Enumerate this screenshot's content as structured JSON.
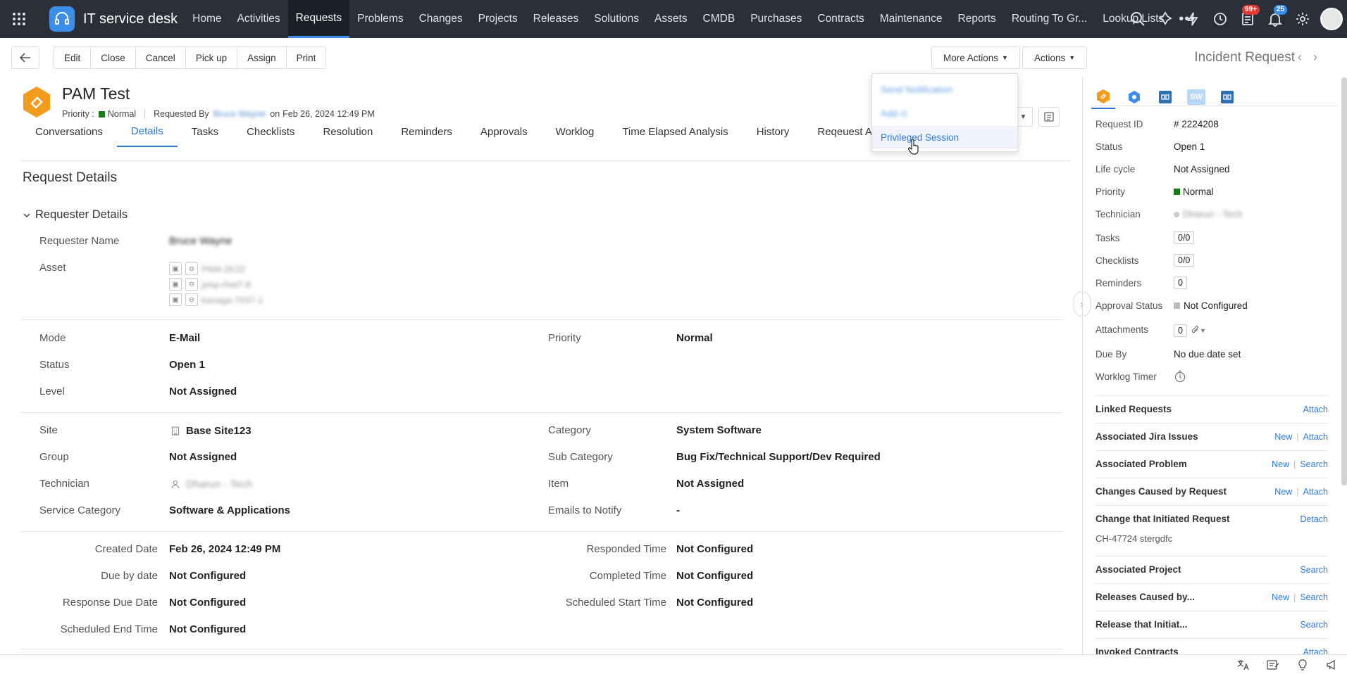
{
  "topbar": {
    "app_name": "IT service desk",
    "nav": [
      "Home",
      "Activities",
      "Requests",
      "Problems",
      "Changes",
      "Projects",
      "Releases",
      "Solutions",
      "Assets",
      "CMDB",
      "Purchases",
      "Contracts",
      "Maintenance",
      "Reports",
      "Routing To Gr...",
      "Lookup Lists"
    ],
    "active_nav": "Requests",
    "more_label": "•••",
    "badges": {
      "tasks": "99+",
      "notifications": "25"
    }
  },
  "toolbar": {
    "buttons": [
      "Edit",
      "Close",
      "Cancel",
      "Pick up",
      "Assign",
      "Print"
    ],
    "more_actions": "More Actions",
    "actions": "Actions",
    "record_type": "Incident Request"
  },
  "more_actions_menu": {
    "items": [
      "Send Notification",
      "Add ci",
      "Privileged Session"
    ],
    "highlighted": "Privileged Session"
  },
  "request": {
    "title": "PAM Test",
    "priority_label": "Priority :",
    "priority": "Normal",
    "requested_by_label": "Requested By",
    "requester": "Bruce Wayne",
    "on_label": "on",
    "date": "Feb 26, 2024 12:49 PM"
  },
  "tabs": [
    "Conversations",
    "Details",
    "Tasks",
    "Checklists",
    "Resolution",
    "Reminders",
    "Approvals",
    "Worklog",
    "Time Elapsed Analysis",
    "History",
    "Reqeuest Appro"
  ],
  "active_tab": "Details",
  "details": {
    "section_title": "Request Details",
    "requester_section": "Requester Details",
    "requester_name_label": "Requester Name",
    "requester_name": "Bruce Wayne",
    "asset_label": "Asset",
    "assets": [
      "PAM-2K22",
      "pmp-rhel7-8",
      "kanaga-7037-1"
    ],
    "mode_label": "Mode",
    "mode": "E-Mail",
    "priority_label": "Priority",
    "priority": "Normal",
    "status_label": "Status",
    "status": "Open 1",
    "level_label": "Level",
    "level": "Not Assigned",
    "site_label": "Site",
    "site": "Base Site123",
    "category_label": "Category",
    "category": "System Software",
    "group_label": "Group",
    "group": "Not Assigned",
    "subcategory_label": "Sub Category",
    "subcategory": "Bug Fix/Technical Support/Dev Required",
    "technician_label": "Technician",
    "technician": "Dharun - Tech",
    "item_label": "Item",
    "item": "Not Assigned",
    "service_category_label": "Service Category",
    "service_category": "Software & Applications",
    "emails_label": "Emails to Notify",
    "emails": "-",
    "created_label": "Created Date",
    "created": "Feb 26, 2024 12:49 PM",
    "responded_label": "Responded Time",
    "responded": "Not Configured",
    "due_label": "Due by date",
    "due": "Not Configured",
    "completed_label": "Completed Time",
    "completed": "Not Configured",
    "response_due_label": "Response Due Date",
    "response_due": "Not Configured",
    "scheduled_start_label": "Scheduled Start Time",
    "scheduled_start": "Not Configured",
    "scheduled_end_label": "Scheduled End Time",
    "scheduled_end": "Not Configured"
  },
  "side_panel": {
    "sw_label": "SW",
    "fields": [
      {
        "label": "Request ID",
        "value": "# 2224208"
      },
      {
        "label": "Status",
        "value": "Open 1"
      },
      {
        "label": "Life cycle",
        "value": "Not Assigned"
      },
      {
        "label": "Priority",
        "value": "Normal"
      },
      {
        "label": "Technician",
        "value": "Dharun - Tech"
      },
      {
        "label": "Tasks",
        "value": "0/0"
      },
      {
        "label": "Checklists",
        "value": "0/0"
      },
      {
        "label": "Reminders",
        "value": "0"
      },
      {
        "label": "Approval Status",
        "value": "Not Configured"
      },
      {
        "label": "Attachments",
        "value": "0"
      },
      {
        "label": "Due By",
        "value": "No due date set"
      },
      {
        "label": "Worklog Timer",
        "value": ""
      }
    ],
    "sections": [
      {
        "title": "Linked Requests",
        "actions": [
          "Attach"
        ]
      },
      {
        "title": "Associated Jira Issues",
        "actions": [
          "New",
          "Attach"
        ]
      },
      {
        "title": "Associated Problem",
        "actions": [
          "New",
          "Search"
        ]
      },
      {
        "title": "Changes Caused by Request",
        "actions": [
          "New",
          "Attach"
        ]
      },
      {
        "title": "Change that Initiated Request",
        "actions": [
          "Detach"
        ]
      },
      {
        "title": "Associated Project",
        "actions": [
          "Search"
        ]
      },
      {
        "title": "Releases Caused by...",
        "actions": [
          "New",
          "Search"
        ]
      },
      {
        "title": "Release that Initiat...",
        "actions": [
          "Search"
        ]
      },
      {
        "title": "Invoked Contracts",
        "actions": [
          "Attach"
        ]
      }
    ],
    "change_reference": "CH-47724 stergdfc"
  },
  "colors": {
    "topbar": "#2a2f3a",
    "accent": "#2f7ad6",
    "priority_normal": "#1b7a1b",
    "request_icon": "#f29b1d"
  }
}
